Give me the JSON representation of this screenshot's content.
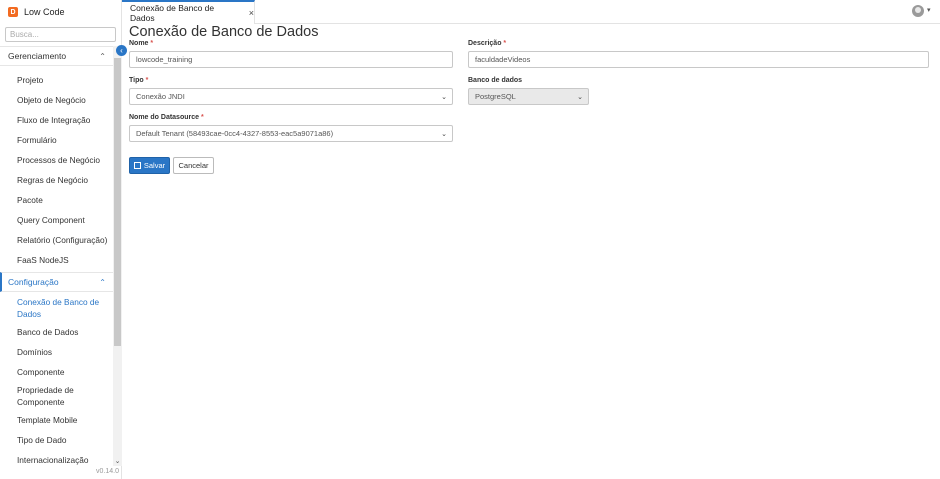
{
  "app": {
    "name": "Low Code",
    "logo_letter": "D",
    "version": "v0.14.0"
  },
  "search": {
    "placeholder": "Busca..."
  },
  "sidebar": {
    "sections": [
      {
        "label": "Gerenciamento",
        "items": [
          "Projeto",
          "Objeto de Negócio",
          "Fluxo de Integração",
          "Formulário",
          "Processos de Negócio",
          "Regras de Negócio",
          "Pacote",
          "Query Component",
          "Relatório (Configuração)",
          "FaaS NodeJS"
        ]
      },
      {
        "label": "Configuração",
        "items": [
          "Conexão de Banco de Dados",
          "Banco de Dados",
          "Domínios",
          "Componente",
          "Propriedade de Componente",
          "Template Mobile",
          "Tipo de Dado",
          "Internacionalização"
        ]
      }
    ]
  },
  "tab": {
    "label": "Conexão de Banco de Dados",
    "close": "×"
  },
  "page": {
    "title": "Conexão de Banco de Dados"
  },
  "form": {
    "nome": {
      "label": "Nome",
      "value": "lowcode_training"
    },
    "descricao": {
      "label": "Descrição",
      "value": "faculdadeVideos"
    },
    "tipo": {
      "label": "Tipo",
      "value": "Conexão JNDI"
    },
    "banco": {
      "label": "Banco de dados",
      "value": "PostgreSQL"
    },
    "datasource": {
      "label": "Nome do Datasource",
      "value": "Default Tenant (58493cae-0cc4-4327-8553-eac5a9071a86)"
    },
    "required_mark": "*"
  },
  "buttons": {
    "save": "Salvar",
    "cancel": "Cancelar"
  },
  "colors": {
    "accent": "#2a76c6",
    "brand": "#f26b21"
  }
}
